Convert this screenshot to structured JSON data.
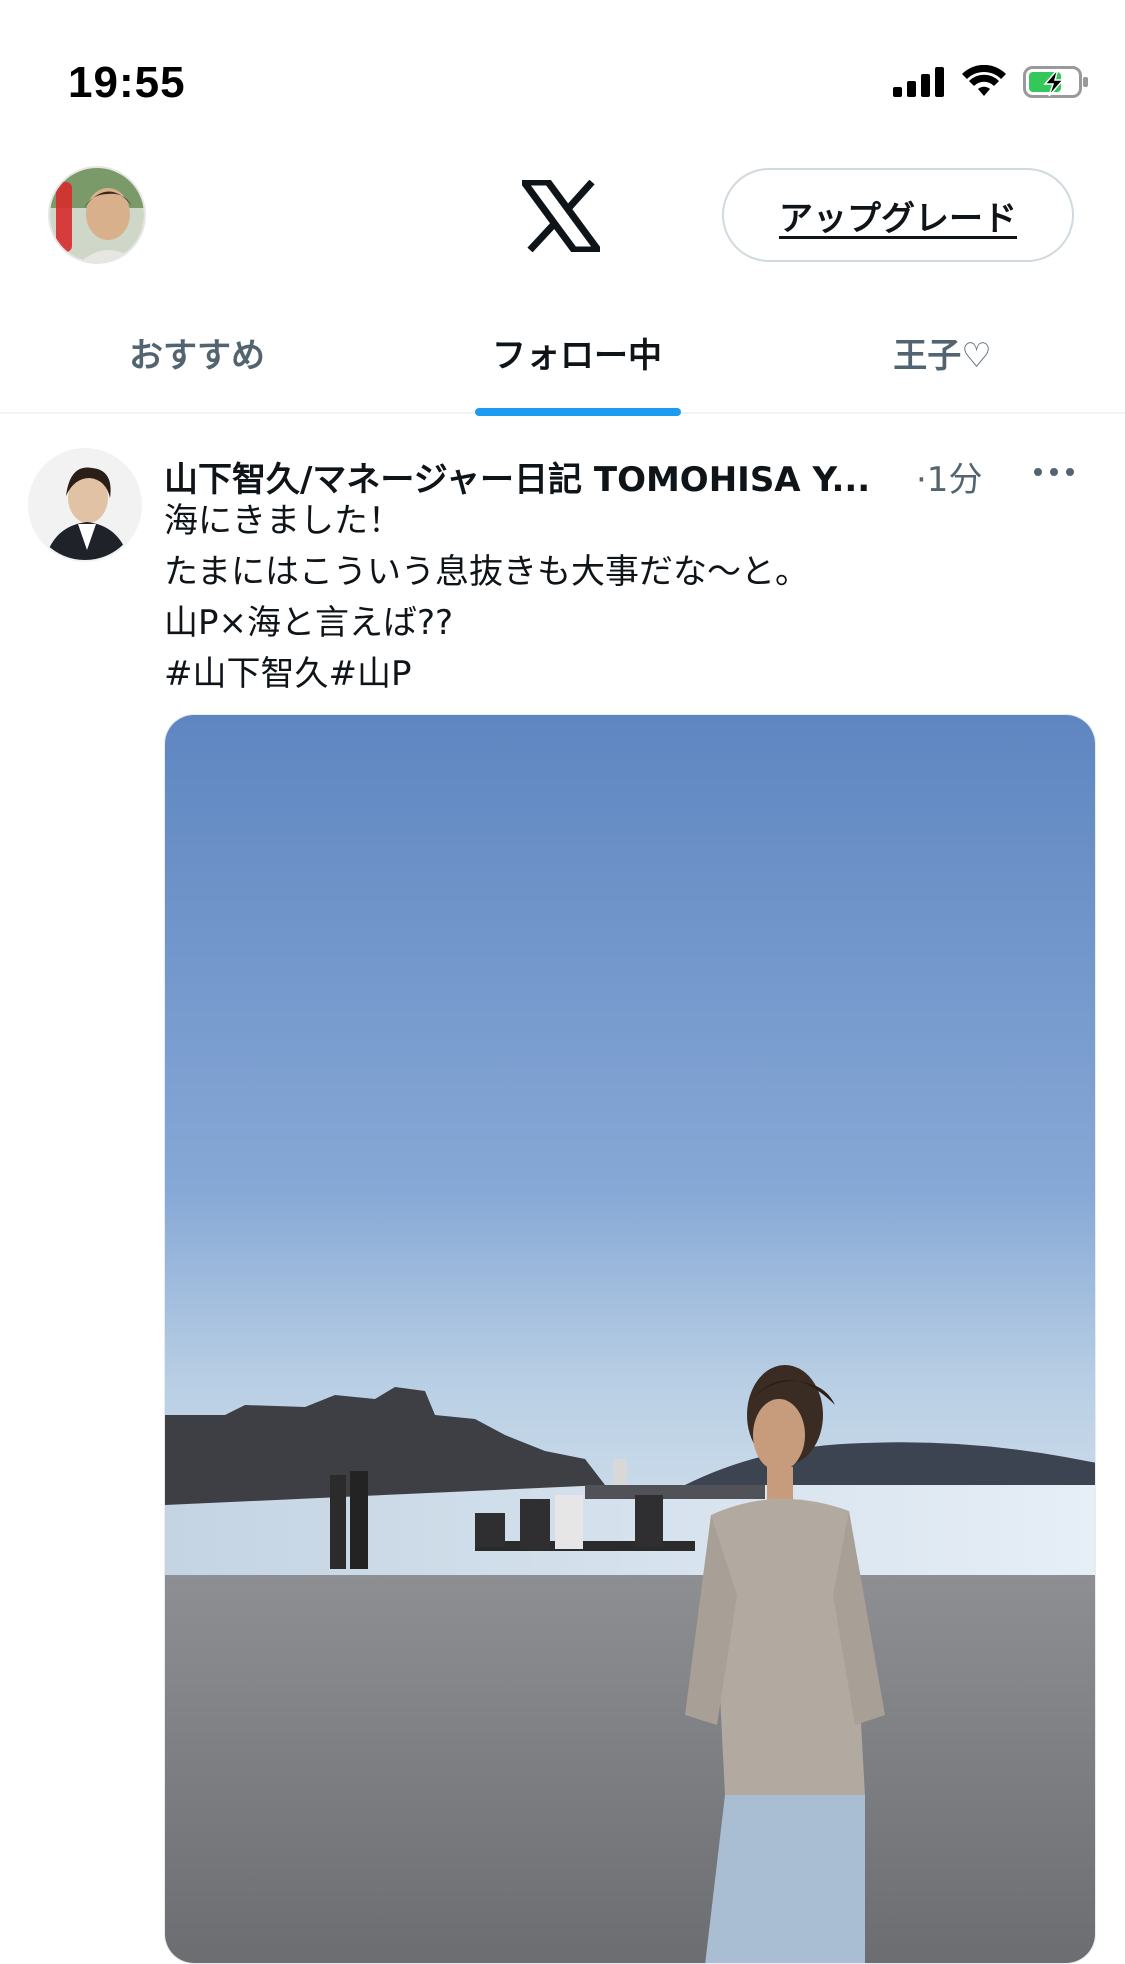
{
  "status_bar": {
    "time": "19:55",
    "icons": [
      "signal-icon",
      "wifi-icon",
      "battery-charging-icon"
    ],
    "battery_color": "#34c759"
  },
  "header": {
    "logo_icon": "x-logo-icon",
    "upgrade_label": "アップグレード"
  },
  "tabs": [
    {
      "label": "おすすめ",
      "active": false
    },
    {
      "label": "フォロー中",
      "active": true
    },
    {
      "label": "王子♡",
      "active": false
    }
  ],
  "accent_color": "#1d9bf0",
  "post": {
    "author": "山下智久/マネージャー日記 TOMOHISA Y...",
    "time": "·1分",
    "more_icon": "more-horizontal-icon",
    "lines": [
      "海にきました！",
      "たまにはこういう息抜きも大事だな〜と。",
      "山P×海と言えば??",
      "#山下智久#山P"
    ]
  }
}
